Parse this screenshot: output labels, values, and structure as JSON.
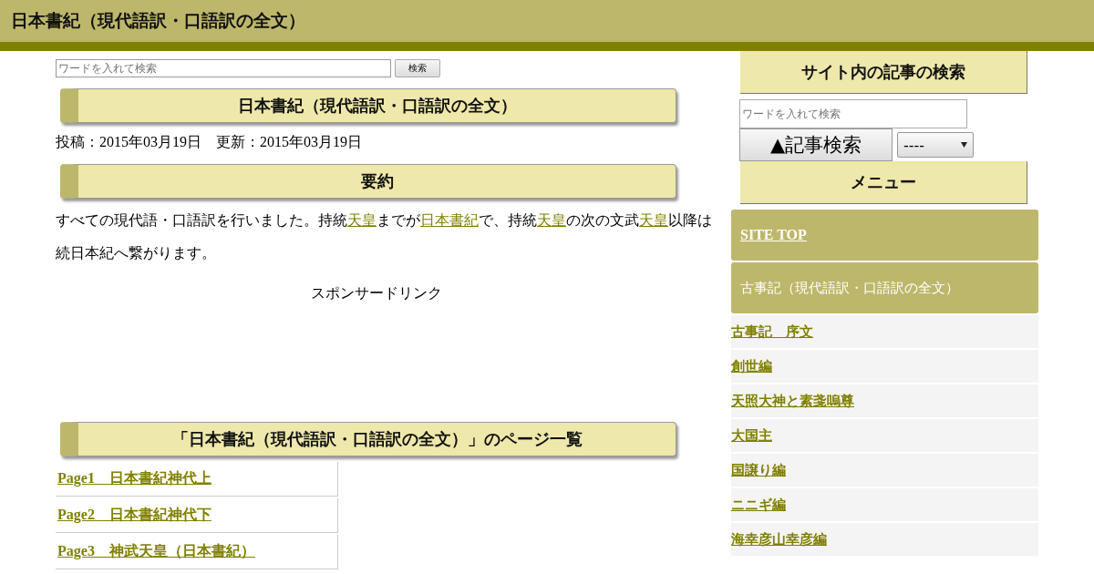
{
  "header": {
    "title": "日本書紀（現代語訳・口語訳の全文）"
  },
  "search": {
    "placeholder": "ワードを入れて検索",
    "button": "検索"
  },
  "article": {
    "title": "日本書紀（現代語訳・口語訳の全文）",
    "posted": "投稿：2015年03月19日　更新：2015年03月19日",
    "summary_heading": "要約",
    "summary": [
      {
        "text": "すべての現代語・口語訳を行いました。持統",
        "link": false
      },
      {
        "text": "天皇",
        "link": true
      },
      {
        "text": "までが",
        "link": false
      },
      {
        "text": "日本書紀",
        "link": true
      },
      {
        "text": "で、持統",
        "link": false
      },
      {
        "text": "天皇",
        "link": true
      },
      {
        "text": "の次の文武",
        "link": false
      },
      {
        "text": "天皇",
        "link": true
      },
      {
        "text": "以降は続日本紀へ繋がります。",
        "link": false
      }
    ],
    "sponsor": "スポンサードリンク",
    "pages_heading": "「日本書紀（現代語訳・口語訳の全文）」のページ一覧",
    "pages": [
      "Page1　日本書紀神代上",
      "Page2　日本書紀神代下",
      "Page3　神武天皇（日本書紀）"
    ]
  },
  "sidebar": {
    "search_heading": "サイト内の記事の検索",
    "placeholder": "ワードを入れて検索",
    "button": "▲記事検索",
    "select": "----",
    "menu_heading": "メニュー",
    "menu": [
      {
        "label": "SITE TOP",
        "kind": "top"
      },
      {
        "label": "古事記（現代語訳・口語訳の全文）",
        "kind": "category"
      },
      {
        "label": "古事記　序文",
        "kind": "page"
      },
      {
        "label": "創世編",
        "kind": "page"
      },
      {
        "label": "天照大神と素戔嗚尊",
        "kind": "page"
      },
      {
        "label": "大国主",
        "kind": "page"
      },
      {
        "label": "国譲り編",
        "kind": "page"
      },
      {
        "label": "ニニギ編",
        "kind": "page"
      },
      {
        "label": "海幸彦山幸彦編",
        "kind": "page"
      }
    ]
  }
}
